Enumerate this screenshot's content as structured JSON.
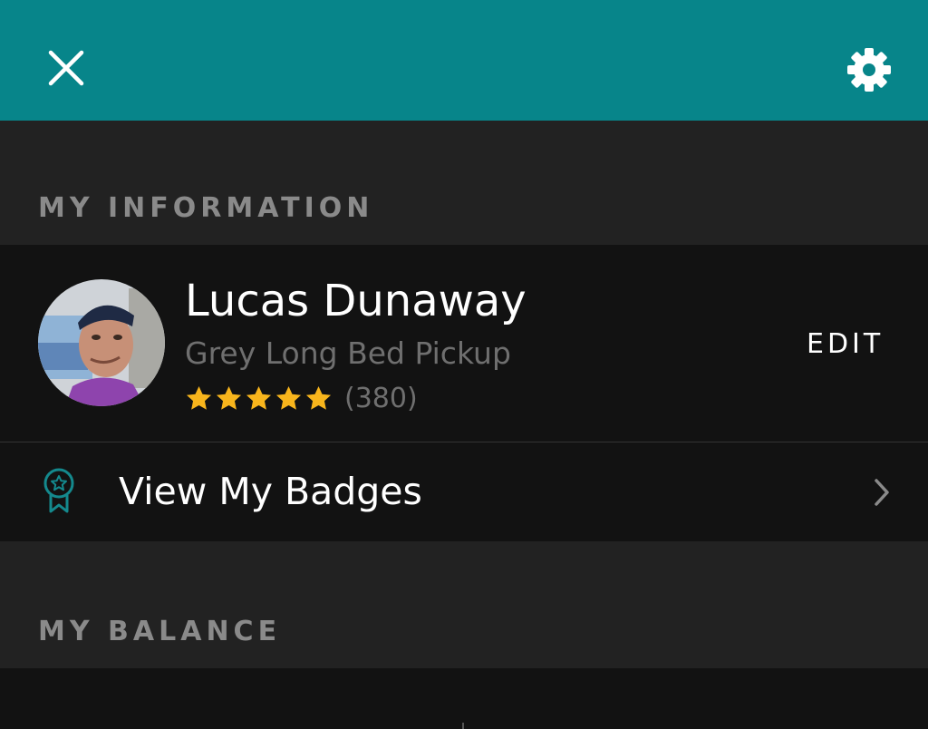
{
  "header": {
    "close_icon": "close-icon",
    "settings_icon": "gear-icon",
    "background_color": "#07858a"
  },
  "my_information": {
    "section_title": "MY INFORMATION",
    "profile": {
      "name": "Lucas Dunaway",
      "vehicle": "Grey Long Bed Pickup",
      "rating_stars": 5,
      "rating_count": "(380)",
      "edit_label": "EDIT",
      "avatar_icon": "avatar"
    },
    "badges": {
      "label": "View My Badges",
      "icon": "badge-icon",
      "chevron_icon": "chevron-right-icon"
    }
  },
  "my_balance": {
    "section_title": "MY BALANCE"
  },
  "colors": {
    "accent": "#07858a",
    "star": "#f8b51c",
    "badge_icon": "#14898d",
    "section_bg": "#222222",
    "row_bg": "#121212"
  }
}
